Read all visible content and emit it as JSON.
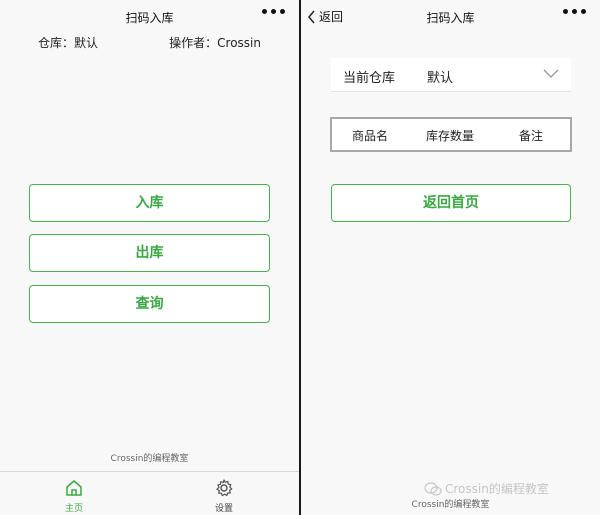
{
  "colors": {
    "accent": "#3aa743",
    "border": "#4caf50",
    "background": "#f8f8f8"
  },
  "left": {
    "title": "扫码入库",
    "more_icon": "more-dots-icon",
    "warehouse_label": "仓库：默认",
    "operator_label": "操作者：Crossin",
    "buttons": {
      "stock_in": "入库",
      "stock_out": "出库",
      "query": "查询"
    },
    "footer": "Crossin的编程教室",
    "tabs": [
      {
        "label": "主页",
        "icon": "home-icon",
        "active": true
      },
      {
        "label": "设置",
        "icon": "gear-icon",
        "active": false
      }
    ]
  },
  "right": {
    "back_label": "返回",
    "title": "扫码入库",
    "more_icon": "more-dots-icon",
    "warehouse_select": {
      "label": "当前仓库",
      "value": "默认",
      "icon": "chevron-down-icon"
    },
    "table_headers": [
      "商品名",
      "库存数量",
      "备注"
    ],
    "home_button": "返回首页",
    "footer": "Crossin的编程教室",
    "watermark": "Crossin的编程教室"
  }
}
